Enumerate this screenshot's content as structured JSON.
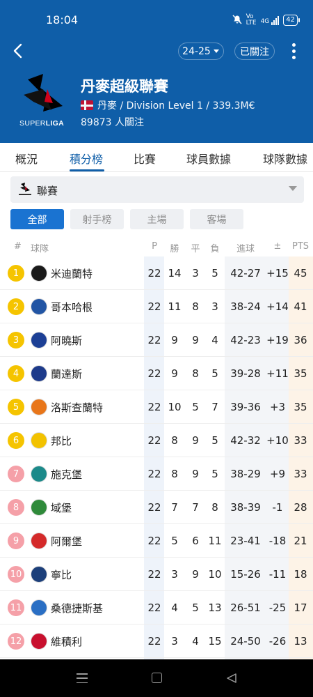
{
  "status_bar": {
    "time": "18:04",
    "signal_text": "4G",
    "battery": "42"
  },
  "header": {
    "season": "24-25",
    "follow_label": "已關注",
    "league_name": "丹麥超級聯賽",
    "league_sub": "丹麥 / Division Level 1 / 339.3M€",
    "followers": "89873 人關注",
    "logo_text": "SUPERLIGA"
  },
  "tabs": [
    {
      "label": "概況"
    },
    {
      "label": "積分榜",
      "active": true
    },
    {
      "label": "比賽"
    },
    {
      "label": "球員數據"
    },
    {
      "label": "球隊數據"
    }
  ],
  "filter": {
    "label": "聯賽"
  },
  "chips": [
    {
      "label": "全部",
      "active": true
    },
    {
      "label": "射手榜"
    },
    {
      "label": "主場"
    },
    {
      "label": "客場"
    }
  ],
  "table": {
    "headers": {
      "rank": "#",
      "team": "球隊",
      "p": "P",
      "w": "勝",
      "d": "平",
      "l": "負",
      "goals": "進球",
      "gd": "±",
      "pts": "PTS"
    },
    "rows": [
      {
        "rank": "1",
        "team": "米迪蘭特",
        "p": "22",
        "w": "14",
        "d": "3",
        "l": "5",
        "goals": "42-27",
        "gd": "+15",
        "pts": "45",
        "rank_color": "#f5c400",
        "crest_color": "#1a1a1a"
      },
      {
        "rank": "2",
        "team": "哥本哈根",
        "p": "22",
        "w": "11",
        "d": "8",
        "l": "3",
        "goals": "38-24",
        "gd": "+14",
        "pts": "41",
        "rank_color": "#f5c400",
        "crest_color": "#2255a4"
      },
      {
        "rank": "3",
        "team": "阿曉斯",
        "p": "22",
        "w": "9",
        "d": "9",
        "l": "4",
        "goals": "42-23",
        "gd": "+19",
        "pts": "36",
        "rank_color": "#f5c400",
        "crest_color": "#1c3f95"
      },
      {
        "rank": "4",
        "team": "蘭達斯",
        "p": "22",
        "w": "9",
        "d": "8",
        "l": "5",
        "goals": "39-28",
        "gd": "+11",
        "pts": "35",
        "rank_color": "#f5c400",
        "crest_color": "#1d3a8a"
      },
      {
        "rank": "5",
        "team": "洛斯查蘭特",
        "p": "22",
        "w": "10",
        "d": "5",
        "l": "7",
        "goals": "39-36",
        "gd": "+3",
        "pts": "35",
        "rank_color": "#f5c400",
        "crest_color": "#e8761a"
      },
      {
        "rank": "6",
        "team": "邦比",
        "p": "22",
        "w": "8",
        "d": "9",
        "l": "5",
        "goals": "42-32",
        "gd": "+10",
        "pts": "33",
        "rank_color": "#f5c400",
        "crest_color": "#f2c200"
      },
      {
        "rank": "7",
        "team": "施克堡",
        "p": "22",
        "w": "8",
        "d": "9",
        "l": "5",
        "goals": "38-29",
        "gd": "+9",
        "pts": "33",
        "rank_color": "#f5a0a8",
        "crest_color": "#1c8a8a"
      },
      {
        "rank": "8",
        "team": "域堡",
        "p": "22",
        "w": "7",
        "d": "7",
        "l": "8",
        "goals": "38-39",
        "gd": "-1",
        "pts": "28",
        "rank_color": "#f5a0a8",
        "crest_color": "#2f8a3a"
      },
      {
        "rank": "9",
        "team": "阿爾堡",
        "p": "22",
        "w": "5",
        "d": "6",
        "l": "11",
        "goals": "23-41",
        "gd": "-18",
        "pts": "21",
        "rank_color": "#f5a0a8",
        "crest_color": "#d42a2a"
      },
      {
        "rank": "10",
        "team": "寧比",
        "p": "22",
        "w": "3",
        "d": "9",
        "l": "10",
        "goals": "15-26",
        "gd": "-11",
        "pts": "18",
        "rank_color": "#f5a0a8",
        "crest_color": "#1c3f7a"
      },
      {
        "rank": "11",
        "team": "桑德捷斯基",
        "p": "22",
        "w": "4",
        "d": "5",
        "l": "13",
        "goals": "26-51",
        "gd": "-25",
        "pts": "17",
        "rank_color": "#f5a0a8",
        "crest_color": "#2a6fc4"
      },
      {
        "rank": "12",
        "team": "維積利",
        "p": "22",
        "w": "3",
        "d": "4",
        "l": "15",
        "goals": "24-50",
        "gd": "-26",
        "pts": "13",
        "rank_color": "#f5a0a8",
        "crest_color": "#c8102e"
      }
    ]
  }
}
